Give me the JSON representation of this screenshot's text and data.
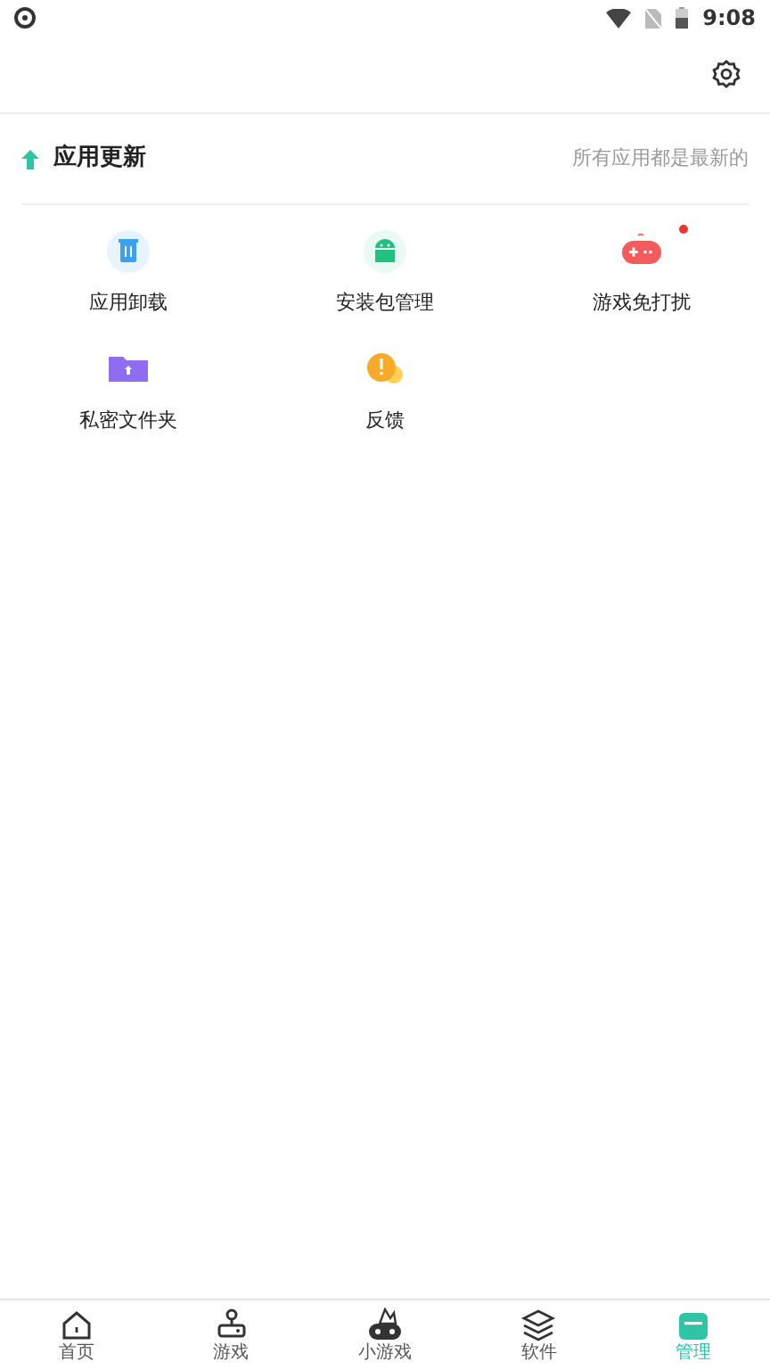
{
  "status_bar": {
    "time": "9:08"
  },
  "update": {
    "title": "应用更新",
    "status": "所有应用都是最新的"
  },
  "tools": [
    {
      "kind": "uninstall",
      "label": "应用卸载",
      "badge": false
    },
    {
      "kind": "package",
      "label": "安装包管理",
      "badge": false
    },
    {
      "kind": "game",
      "label": "游戏免打扰",
      "badge": true
    },
    {
      "kind": "folder",
      "label": "私密文件夹",
      "badge": false
    },
    {
      "kind": "feedback",
      "label": "反馈",
      "badge": false
    }
  ],
  "nav": [
    {
      "kind": "home",
      "label": "首页",
      "selected": false
    },
    {
      "kind": "game",
      "label": "游戏",
      "selected": false
    },
    {
      "kind": "minigame",
      "label": "小游戏",
      "selected": false
    },
    {
      "kind": "software",
      "label": "软件",
      "selected": false
    },
    {
      "kind": "manage",
      "label": "管理",
      "selected": true
    }
  ]
}
